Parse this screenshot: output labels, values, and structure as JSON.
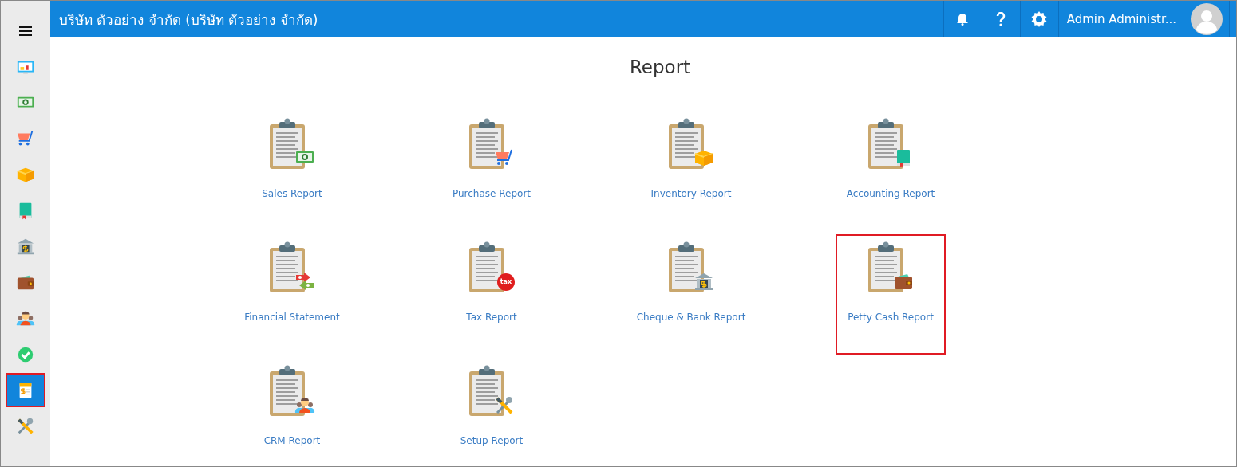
{
  "header": {
    "company": "บริษัท ตัวอย่าง จำกัด (บริษัท ตัวอย่าง จำกัด)",
    "user_name": "Admin Administr..."
  },
  "sidebar": {
    "items": [
      {
        "selected": false,
        "highlighted": false
      },
      {
        "selected": false,
        "highlighted": false
      },
      {
        "selected": false,
        "highlighted": false
      },
      {
        "selected": false,
        "highlighted": false
      },
      {
        "selected": false,
        "highlighted": false
      },
      {
        "selected": false,
        "highlighted": false
      },
      {
        "selected": false,
        "highlighted": false
      },
      {
        "selected": false,
        "highlighted": false
      },
      {
        "selected": false,
        "highlighted": false
      },
      {
        "selected": true,
        "highlighted": true
      },
      {
        "selected": false,
        "highlighted": false
      }
    ]
  },
  "page_title": "Report",
  "reports": [
    {
      "label": "Sales Report",
      "highlighted": false
    },
    {
      "label": "Purchase Report",
      "highlighted": false
    },
    {
      "label": "Inventory Report",
      "highlighted": false
    },
    {
      "label": "Accounting Report",
      "highlighted": false
    },
    {
      "label": "Financial Statement",
      "highlighted": false
    },
    {
      "label": "Tax Report",
      "highlighted": false,
      "badge": "tax"
    },
    {
      "label": "Cheque & Bank Report",
      "highlighted": false
    },
    {
      "label": "Petty Cash Report",
      "highlighted": true
    },
    {
      "label": "CRM Report",
      "highlighted": false
    },
    {
      "label": "Setup Report",
      "highlighted": false
    }
  ]
}
